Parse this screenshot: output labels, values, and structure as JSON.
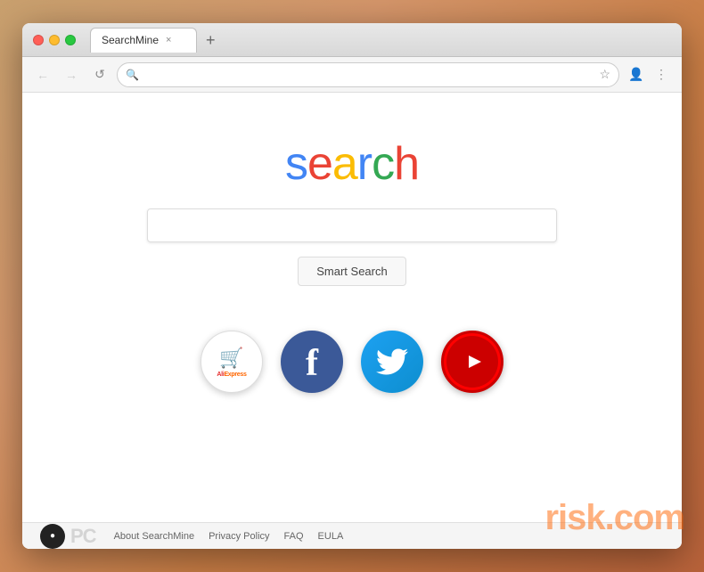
{
  "browser": {
    "title": "SearchMine",
    "tab_label": "SearchMine",
    "tab_close": "×",
    "tab_new": "+",
    "url_placeholder": "",
    "url_value": ""
  },
  "nav": {
    "back_label": "←",
    "forward_label": "→",
    "reload_label": "↺",
    "star_icon": "☆",
    "profile_icon": "👤",
    "menu_icon": "⋮"
  },
  "page": {
    "logo_s": "s",
    "logo_e": "e",
    "logo_a": "a",
    "logo_r": "r",
    "logo_c": "c",
    "logo_h": "h",
    "search_placeholder": "",
    "smart_search_label": "Smart Search"
  },
  "social_links": [
    {
      "name": "aliexpress",
      "label": "AliExpress"
    },
    {
      "name": "facebook",
      "label": "Facebook"
    },
    {
      "name": "twitter",
      "label": "Twitter"
    },
    {
      "name": "youtube",
      "label": "YouTube"
    }
  ],
  "footer": {
    "about_label": "About SearchMine",
    "privacy_label": "Privacy Policy",
    "faq_label": "FAQ",
    "eula_label": "EULA",
    "pcrisk_text": "PC",
    "watermark": "risk.com"
  }
}
